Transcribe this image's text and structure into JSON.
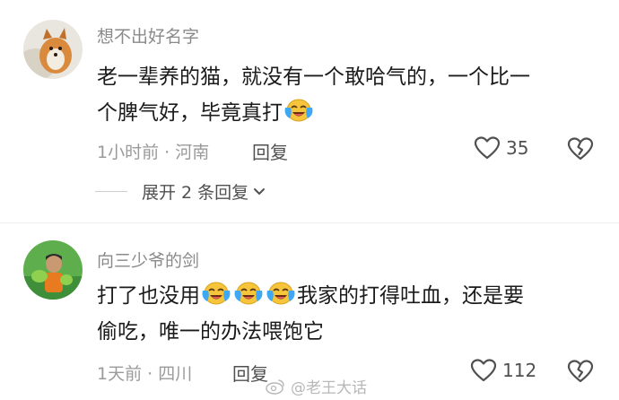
{
  "comments": [
    {
      "username": "想不出好名字",
      "text_line1": "老一辈养的猫，就没有一个敢哈气的，一个比一",
      "text_line2": "个脾气好，毕竟真打",
      "time": "1小时前",
      "location": "河南",
      "reply_label": "回复",
      "likes": "35",
      "expand_label": "展开 2 条回复"
    },
    {
      "username": "向三少爷的剑",
      "text_line1_after_emoji": "我家的打得吐血，还是要",
      "text_line2": "偷吃，唯一的办法喂饱它",
      "text_line1_before_emoji": "打了也没用",
      "time": "1天前",
      "location": "四川",
      "reply_label": "回复",
      "likes": "112"
    }
  ],
  "meta_separator": "·",
  "watermark": {
    "text": "@老王大话",
    "icon": "weibo-icon"
  },
  "colors": {
    "muted_text": "#9a9a9a",
    "body_text": "#1b1b1b",
    "emoji_yellow": "#f7c53b",
    "emoji_tear": "#3fa8f4"
  },
  "icons": {
    "like": "heart-outline-icon",
    "dislike": "broken-heart-icon",
    "expand": "chevron-down-icon",
    "emoji": "crying-laughing-emoji"
  }
}
